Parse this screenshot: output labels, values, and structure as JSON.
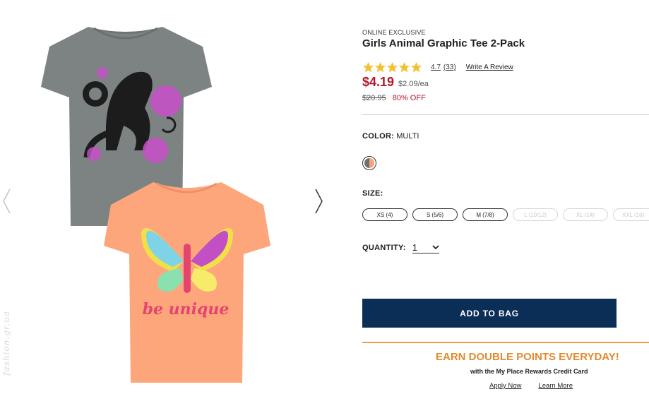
{
  "gallery": {
    "prev_icon": "chevron-left-icon",
    "next_icon": "chevron-right-icon",
    "watermark": "fashion.gr.ua",
    "shirt1": {
      "color": "#7a8180",
      "print_color": "#c94fc9"
    },
    "shirt2": {
      "color": "#fda67c",
      "text": "be unique",
      "text_color": "#e4456f"
    }
  },
  "product": {
    "eyebrow": "ONLINE EXCLUSIVE",
    "title": "Girls Animal Graphic Tee 2-Pack",
    "rating_value": "4.7",
    "rating_count": "(33)",
    "write_review": "Write A Review",
    "price": "$4.19",
    "unit_price": "$2.09/ea",
    "original_price": "$20.95",
    "discount": "80% OFF"
  },
  "color": {
    "label": "COLOR:",
    "value": "MULTI"
  },
  "size": {
    "label": "SIZE:",
    "options": [
      {
        "label": "XS (4)",
        "available": true
      },
      {
        "label": "S (5/6)",
        "available": true
      },
      {
        "label": "M (7/8)",
        "available": true
      },
      {
        "label": "L (10/12)",
        "available": false
      },
      {
        "label": "XL (14)",
        "available": false
      },
      {
        "label": "XXL (16)",
        "available": false
      }
    ]
  },
  "quantity": {
    "label": "QUANTITY:",
    "value": "1"
  },
  "add_to_bag": "ADD TO BAG",
  "promo": {
    "title": "EARN DOUBLE POINTS EVERYDAY!",
    "subtitle": "with the My Place Rewards Credit Card",
    "apply": "Apply Now",
    "learn": "Learn More"
  },
  "colors": {
    "price": "#b3192d",
    "button": "#0b2e57",
    "promo": "#e28a2f",
    "star": "#f2c230"
  }
}
